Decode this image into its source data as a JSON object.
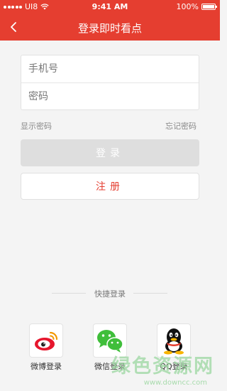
{
  "status_bar": {
    "carrier": "UI8",
    "time": "9:41 AM",
    "battery": "100%"
  },
  "nav": {
    "title": "登录即时看点"
  },
  "form": {
    "phone_placeholder": "手机号",
    "password_placeholder": "密码"
  },
  "links": {
    "show_password": "显示密码",
    "forgot_password": "忘记密码"
  },
  "buttons": {
    "login": "登录",
    "register": "注册"
  },
  "quick_login": {
    "title": "快捷登录",
    "items": [
      {
        "label": "微博登录",
        "icon": "weibo-icon"
      },
      {
        "label": "微信登录",
        "icon": "wechat-icon"
      },
      {
        "label": "QQ登录",
        "icon": "qq-icon"
      }
    ]
  },
  "watermark": {
    "text": "绿色资源网",
    "url": "www.downcc.com"
  },
  "colors": {
    "brand_red": "#e53e30",
    "disabled_gray": "#dedede",
    "wechat_green": "#3fbe3a"
  }
}
